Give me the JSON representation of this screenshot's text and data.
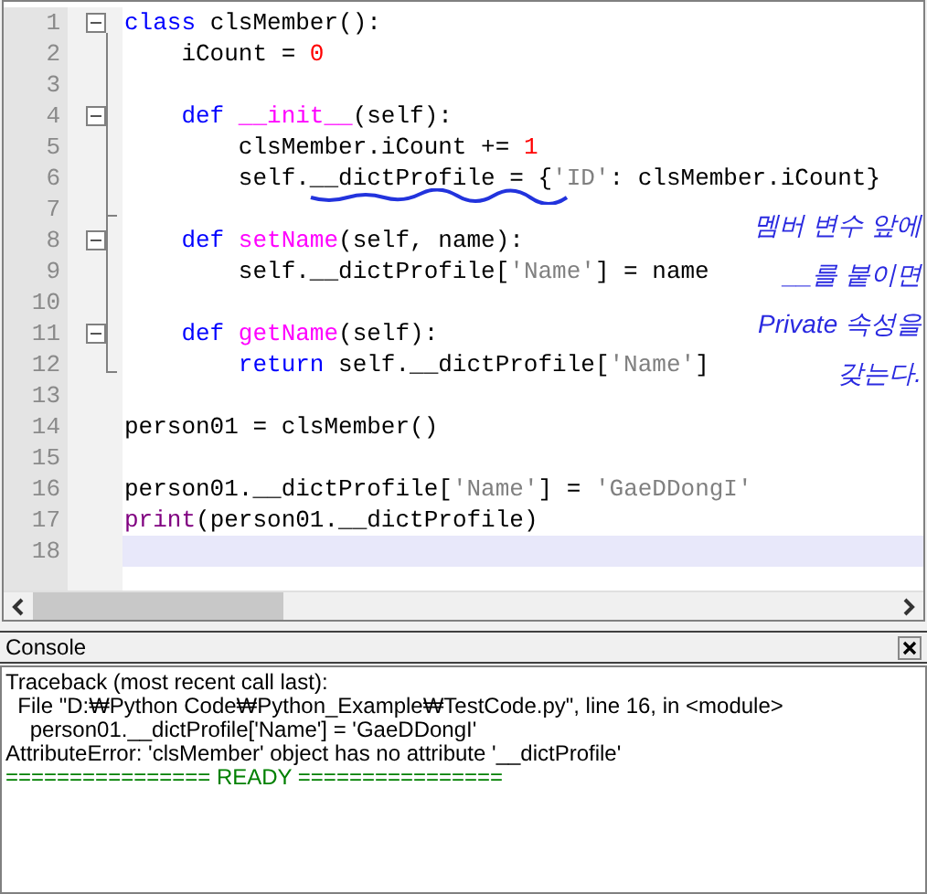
{
  "editor": {
    "lines": [
      {
        "number": "1",
        "fold_box": true,
        "segments": [
          {
            "kind": "keyword",
            "text": "class"
          },
          {
            "kind": "plain",
            "text": " clsMember():"
          }
        ]
      },
      {
        "number": "2",
        "fold_box": false,
        "segments": [
          {
            "kind": "plain",
            "text": "    iCount = "
          },
          {
            "kind": "number",
            "text": "0"
          }
        ]
      },
      {
        "number": "3",
        "fold_box": false
      },
      {
        "number": "4",
        "fold_box": true,
        "segments": [
          {
            "kind": "keyword",
            "text": "    def"
          },
          {
            "kind": "function",
            "text": " __init__"
          },
          {
            "kind": "plain",
            "text": "(self):"
          }
        ]
      },
      {
        "number": "5",
        "fold_box": false,
        "segments": [
          {
            "kind": "plain",
            "text": "        clsMember.iCount += "
          },
          {
            "kind": "number",
            "text": "1"
          }
        ]
      },
      {
        "number": "6",
        "fold_box": false,
        "segments": [
          {
            "kind": "plain",
            "text": "        self.__dictProfile = {"
          },
          {
            "kind": "string",
            "text": "'ID'"
          },
          {
            "kind": "plain",
            "text": ": clsMember.iCount}"
          }
        ]
      },
      {
        "number": "7",
        "fold_box": false
      },
      {
        "number": "8",
        "fold_box": true,
        "segments": [
          {
            "kind": "keyword",
            "text": "    def"
          },
          {
            "kind": "function",
            "text": " setName"
          },
          {
            "kind": "plain",
            "text": "(self, name):"
          }
        ]
      },
      {
        "number": "9",
        "fold_box": false,
        "segments": [
          {
            "kind": "plain",
            "text": "        self.__dictProfile["
          },
          {
            "kind": "string",
            "text": "'Name'"
          },
          {
            "kind": "plain",
            "text": "] = name"
          }
        ]
      },
      {
        "number": "10",
        "fold_box": false
      },
      {
        "number": "11",
        "fold_box": true,
        "segments": [
          {
            "kind": "keyword",
            "text": "    def"
          },
          {
            "kind": "function",
            "text": " getName"
          },
          {
            "kind": "plain",
            "text": "(self):"
          }
        ]
      },
      {
        "number": "12",
        "fold_box": false,
        "segments": [
          {
            "kind": "keyword",
            "text": "        return"
          },
          {
            "kind": "plain",
            "text": " self.__dictProfile["
          },
          {
            "kind": "string",
            "text": "'Name'"
          },
          {
            "kind": "plain",
            "text": "]"
          }
        ]
      },
      {
        "number": "13",
        "fold_box": false
      },
      {
        "number": "14",
        "fold_box": false,
        "segments": [
          {
            "kind": "plain",
            "text": "person01 = clsMember()"
          }
        ]
      },
      {
        "number": "15",
        "fold_box": false
      },
      {
        "number": "16",
        "fold_box": false,
        "segments": [
          {
            "kind": "plain",
            "text": "person01.__dictProfile["
          },
          {
            "kind": "string",
            "text": "'Name'"
          },
          {
            "kind": "plain",
            "text": "] = "
          },
          {
            "kind": "string",
            "text": "'GaeDDongI'"
          }
        ]
      },
      {
        "number": "17",
        "fold_box": false,
        "segments": [
          {
            "kind": "builtin",
            "text": "print"
          },
          {
            "kind": "plain",
            "text": "(person01.__dictProfile)"
          }
        ]
      },
      {
        "number": "18",
        "fold_box": false,
        "current": true
      }
    ],
    "annotation": [
      "멤버 변수 앞에",
      "__를 붙이면",
      "Private 속성을",
      "갖는다."
    ]
  },
  "console": {
    "title": "Console",
    "lines": [
      {
        "kind": "text",
        "text": "Traceback (most recent call last):"
      },
      {
        "kind": "text",
        "text": "  File \"D:₩Python Code₩Python_Example₩TestCode.py\", line 16, in <module>"
      },
      {
        "kind": "text",
        "text": "    person01.__dictProfile['Name'] = 'GaeDDongI'"
      },
      {
        "kind": "text",
        "text": "AttributeError: 'clsMember' object has no attribute '__dictProfile'"
      },
      {
        "kind": "ready",
        "text": "================ READY ================"
      }
    ]
  }
}
